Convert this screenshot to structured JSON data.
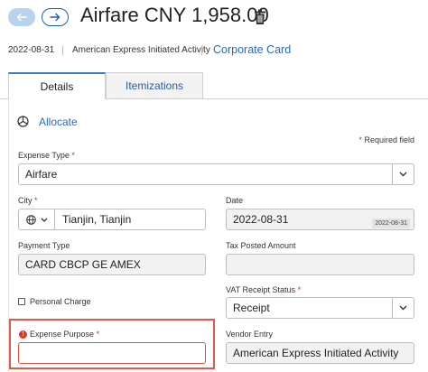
{
  "header": {
    "back_icon": "arrow-left-icon",
    "forward_icon": "arrow-right-icon",
    "title": "Airfare CNY 1,958.00",
    "delete_icon": "trash-icon"
  },
  "meta": {
    "date": "2022-08-31",
    "activity": "American Express Initiated Activity",
    "card_link": "Corporate Card"
  },
  "tabs": [
    {
      "label": "Details",
      "active": true
    },
    {
      "label": "Itemizations",
      "active": false
    }
  ],
  "allocate": {
    "label": "Allocate",
    "icon": "pie-chart-icon"
  },
  "required_note": {
    "star": "*",
    "text": "Required field"
  },
  "form": {
    "expense_type": {
      "label": "Expense Type",
      "star": "*",
      "value": "Airfare"
    },
    "city": {
      "label": "City",
      "star": "*",
      "value": "Tianjin, Tianjin",
      "icon": "globe-icon"
    },
    "date": {
      "label": "Date",
      "value": "2022-08-31",
      "chip": "2022-08-31"
    },
    "payment_type": {
      "label": "Payment Type",
      "value": "CARD CBCP GE AMEX"
    },
    "tax_posted_amount": {
      "label": "Tax Posted Amount",
      "value": ""
    },
    "personal_charge": {
      "label": "Personal Charge",
      "checked": false
    },
    "vat_receipt_status": {
      "label": "VAT Receipt Status",
      "star": "*",
      "value": "Receipt"
    },
    "expense_purpose": {
      "label": "Expense Purpose",
      "star": "*",
      "value": "",
      "error_icon": "!"
    },
    "vendor_entry": {
      "label": "Vendor Entry",
      "value": "American Express Initiated Activity"
    }
  },
  "colors": {
    "link": "#2a6bb5",
    "required": "#c0392b",
    "error_frame": "#e05a4a",
    "tab_accent": "#3a7bd5"
  }
}
